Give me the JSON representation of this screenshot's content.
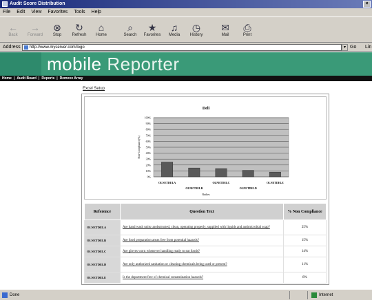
{
  "window": {
    "title": "Audit Score Distribution",
    "close_label": "×"
  },
  "menu": [
    "File",
    "Edit",
    "View",
    "Favorites",
    "Tools",
    "Help"
  ],
  "toolbar": [
    {
      "label": "Back",
      "icon": "back-icon",
      "glyph": "←",
      "disabled": true
    },
    {
      "label": "Forward",
      "icon": "forward-icon",
      "glyph": "→",
      "disabled": true
    },
    {
      "label": "Stop",
      "icon": "stop-icon",
      "glyph": "⊗",
      "disabled": false
    },
    {
      "label": "Refresh",
      "icon": "refresh-icon",
      "glyph": "↻",
      "disabled": false
    },
    {
      "label": "Home",
      "icon": "home-icon",
      "glyph": "⌂",
      "disabled": false
    },
    {
      "label": "Search",
      "icon": "search-icon",
      "glyph": "⌕",
      "disabled": false
    },
    {
      "label": "Favorites",
      "icon": "favorites-icon",
      "glyph": "★",
      "disabled": false
    },
    {
      "label": "Media",
      "icon": "media-icon",
      "glyph": "♫",
      "disabled": false
    },
    {
      "label": "History",
      "icon": "history-icon",
      "glyph": "◷",
      "disabled": false
    },
    {
      "label": "Mail",
      "icon": "mail-icon",
      "glyph": "✉",
      "disabled": false
    },
    {
      "label": "Print",
      "icon": "print-icon",
      "glyph": "⎙",
      "disabled": false
    }
  ],
  "address": {
    "label": "Address",
    "url": "http://www.myserver.com/logo",
    "go_label": "Go",
    "links_label": "Lin"
  },
  "banner": {
    "word1": "mobile",
    "word2": "Reporter"
  },
  "nav": [
    "Home",
    "|",
    "Audit Board",
    "|",
    "Reports",
    "|",
    "Remove Array"
  ],
  "excel_link": "Excel Setup",
  "chart_data": {
    "type": "bar",
    "title": "Deli",
    "xlabel": "Ruthes",
    "ylabel": "Non-Compliance(%)",
    "ylim": [
      0,
      100
    ],
    "yticks": [
      "100%",
      "90%",
      "80%",
      "70%",
      "60%",
      "50%",
      "40%",
      "30%",
      "20%",
      "10%",
      "0%"
    ],
    "categories": [
      "OLNETDELA",
      "OLNETDELB",
      "OLNETDELC",
      "OLNETDELD",
      "OLNETDELE"
    ],
    "values": [
      25,
      15,
      14,
      11,
      8
    ],
    "bar_color": "#5a5a5a",
    "plot_bg": "#c0c0c0"
  },
  "table": {
    "headers": [
      "Reference",
      "Question Text",
      "% Non Compliance"
    ],
    "rows": [
      {
        "ref": "OLNETDELA",
        "text": "Are hand wash units unobstructed, clean, operating properly, supplied with liquids and antimicrobial soap?",
        "pct": "25%"
      },
      {
        "ref": "OLNETDELB",
        "text": "Are food preparation areas free from potential hazards?",
        "pct": "15%"
      },
      {
        "ref": "OLNETDELC",
        "text": "Are gloves worn whenever handling ready to eat foods?",
        "pct": "14%"
      },
      {
        "ref": "OLNETDELD",
        "text": "Are only authorized sanitation or cleaning chemicals being used or present?",
        "pct": "11%"
      },
      {
        "ref": "OLNETDELE",
        "text": "Is the department free of chemical contamination hazards?",
        "pct": "8%"
      }
    ]
  },
  "status": {
    "text": "Done",
    "zone": "Internet"
  }
}
